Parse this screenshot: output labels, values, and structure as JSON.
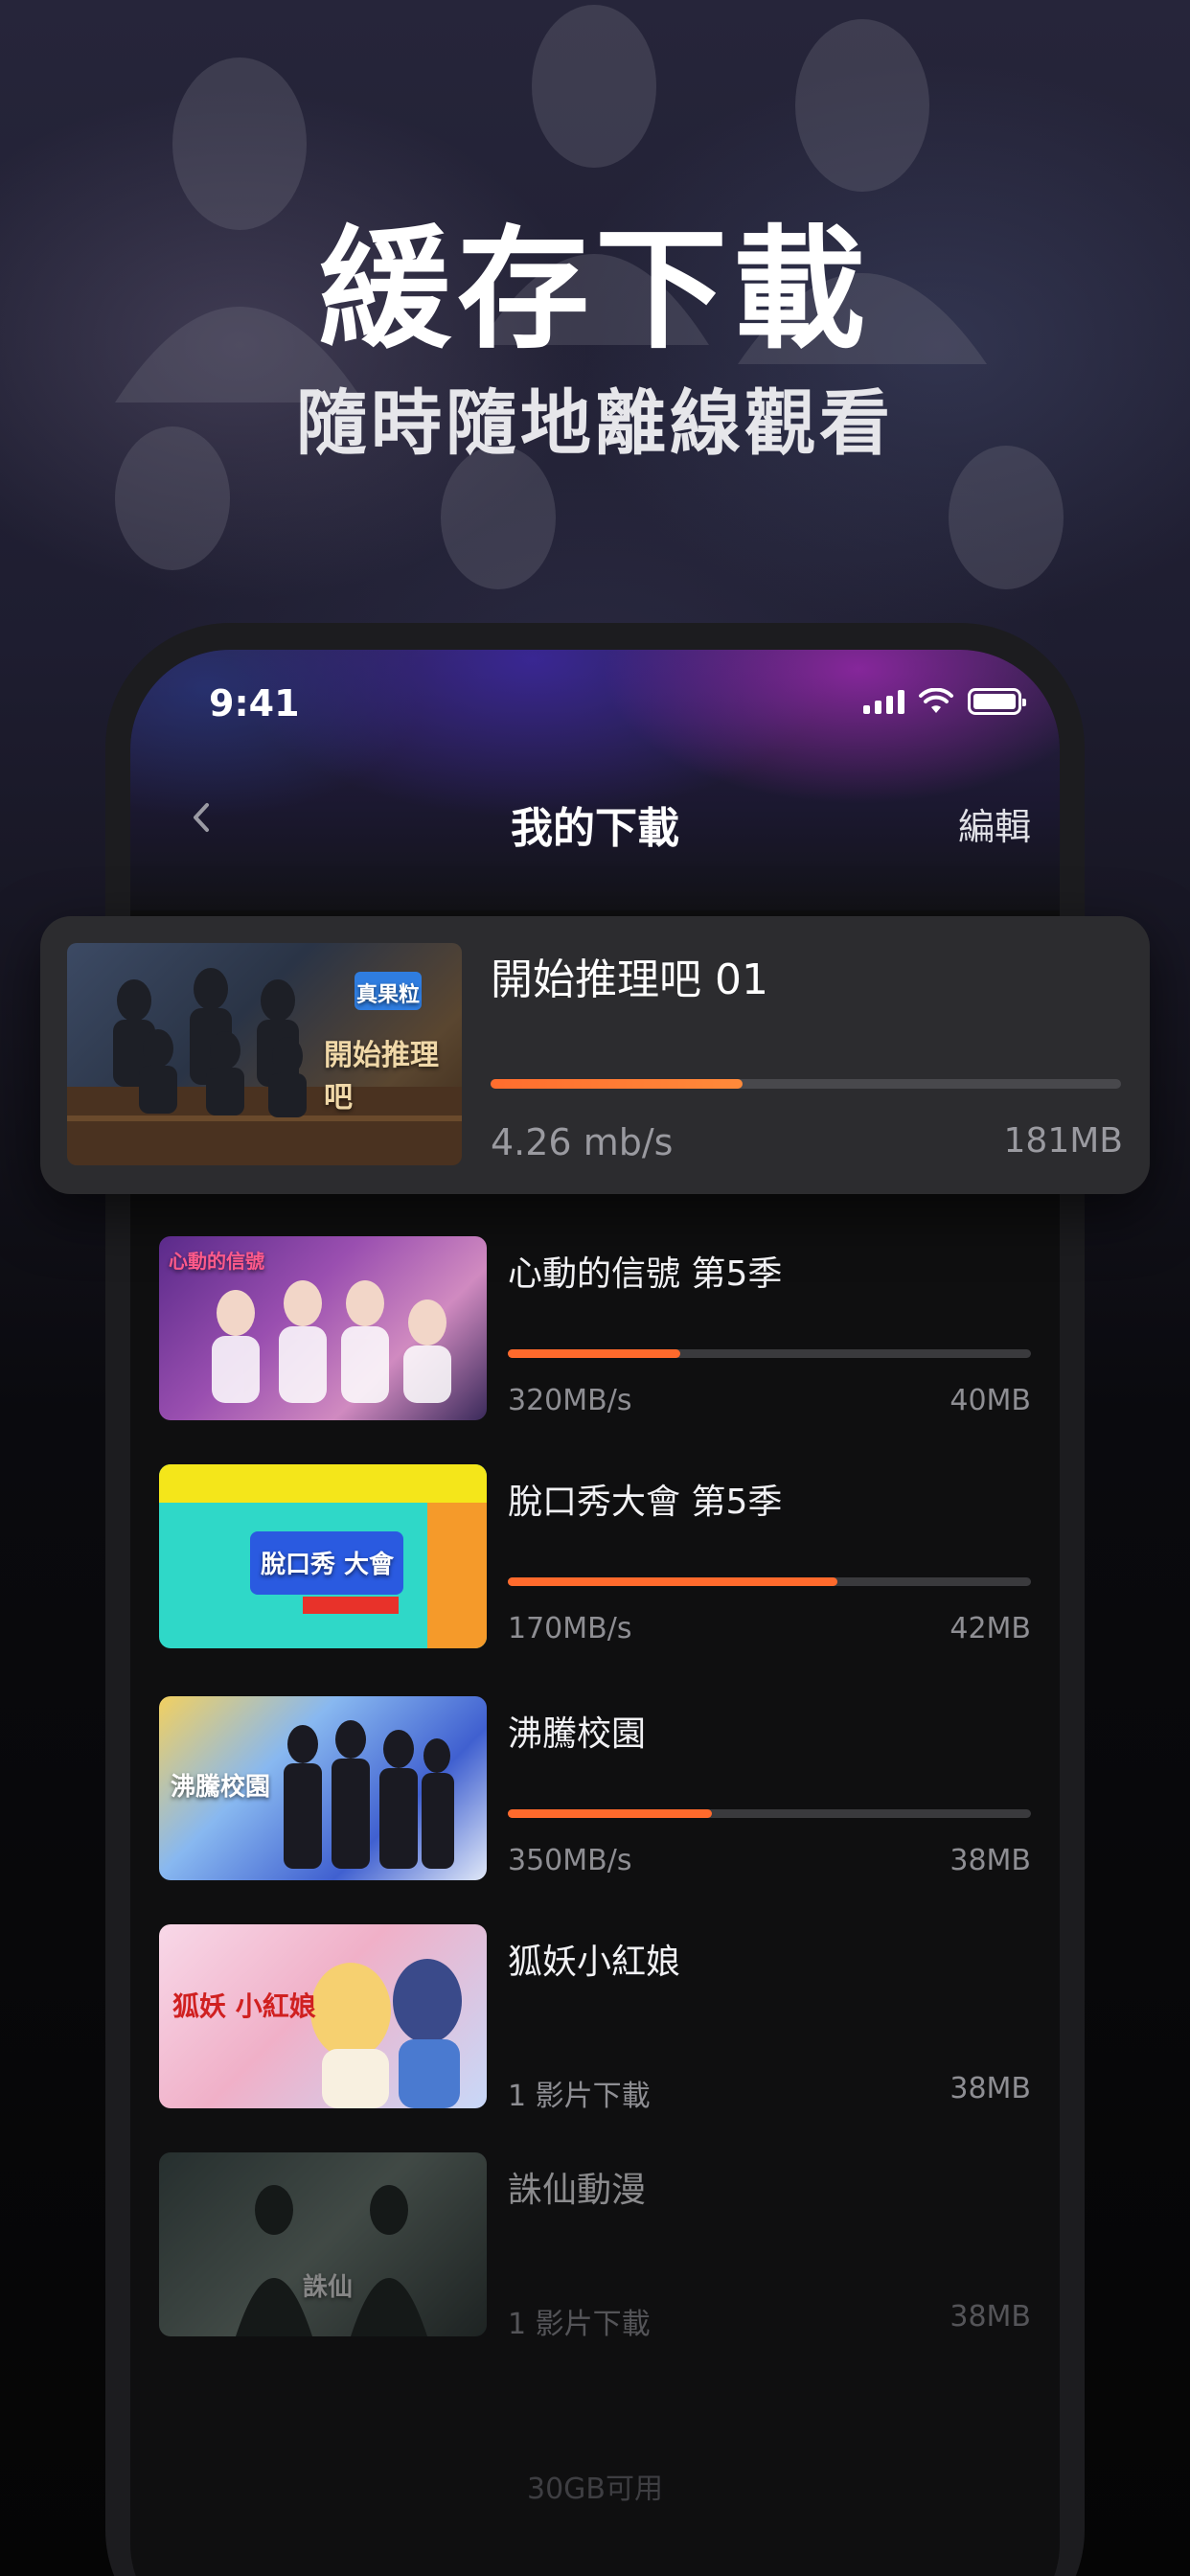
{
  "hero": {
    "title": "緩存下載",
    "subtitle": "隨時隨地離線觀看"
  },
  "status_bar": {
    "time": "9:41",
    "icons": [
      "signal-icon",
      "wifi-icon",
      "battery-icon"
    ]
  },
  "nav": {
    "back_icon": "chevron-left-icon",
    "title": "我的下載",
    "edit_label": "編輯"
  },
  "featured": {
    "title": "開始推理吧 01",
    "speed": "4.26 mb/s",
    "size": "181MB",
    "progress": 0.4,
    "thumb_text": "開始推理吧",
    "thumb_badge": "真果粒"
  },
  "downloads": [
    {
      "title": "心動的信號 第5季",
      "left": "320MB/s",
      "right": "40MB",
      "progress": 0.33,
      "thumb_text": "心動的信號"
    },
    {
      "title": "脫口秀大會 第5季",
      "left": "170MB/s",
      "right": "42MB",
      "progress": 0.63,
      "thumb_text": "脫口秀 大會"
    },
    {
      "title": "沸騰校園",
      "left": "350MB/s",
      "right": "38MB",
      "progress": 0.39,
      "thumb_text": "沸騰校園"
    },
    {
      "title": "狐妖小紅娘",
      "left": "1 影片下載",
      "right": "38MB",
      "progress": null,
      "thumb_text": "狐妖 小紅娘"
    },
    {
      "title": "誅仙動漫",
      "left": "1 影片下載",
      "right": "38MB",
      "progress": null,
      "thumb_text": "誅仙"
    }
  ],
  "storage_label": "30GB可用",
  "colors": {
    "accent": "#ff6a2c",
    "card_bg": "#2c2c2f",
    "screen_bg": "#0f0f10"
  }
}
